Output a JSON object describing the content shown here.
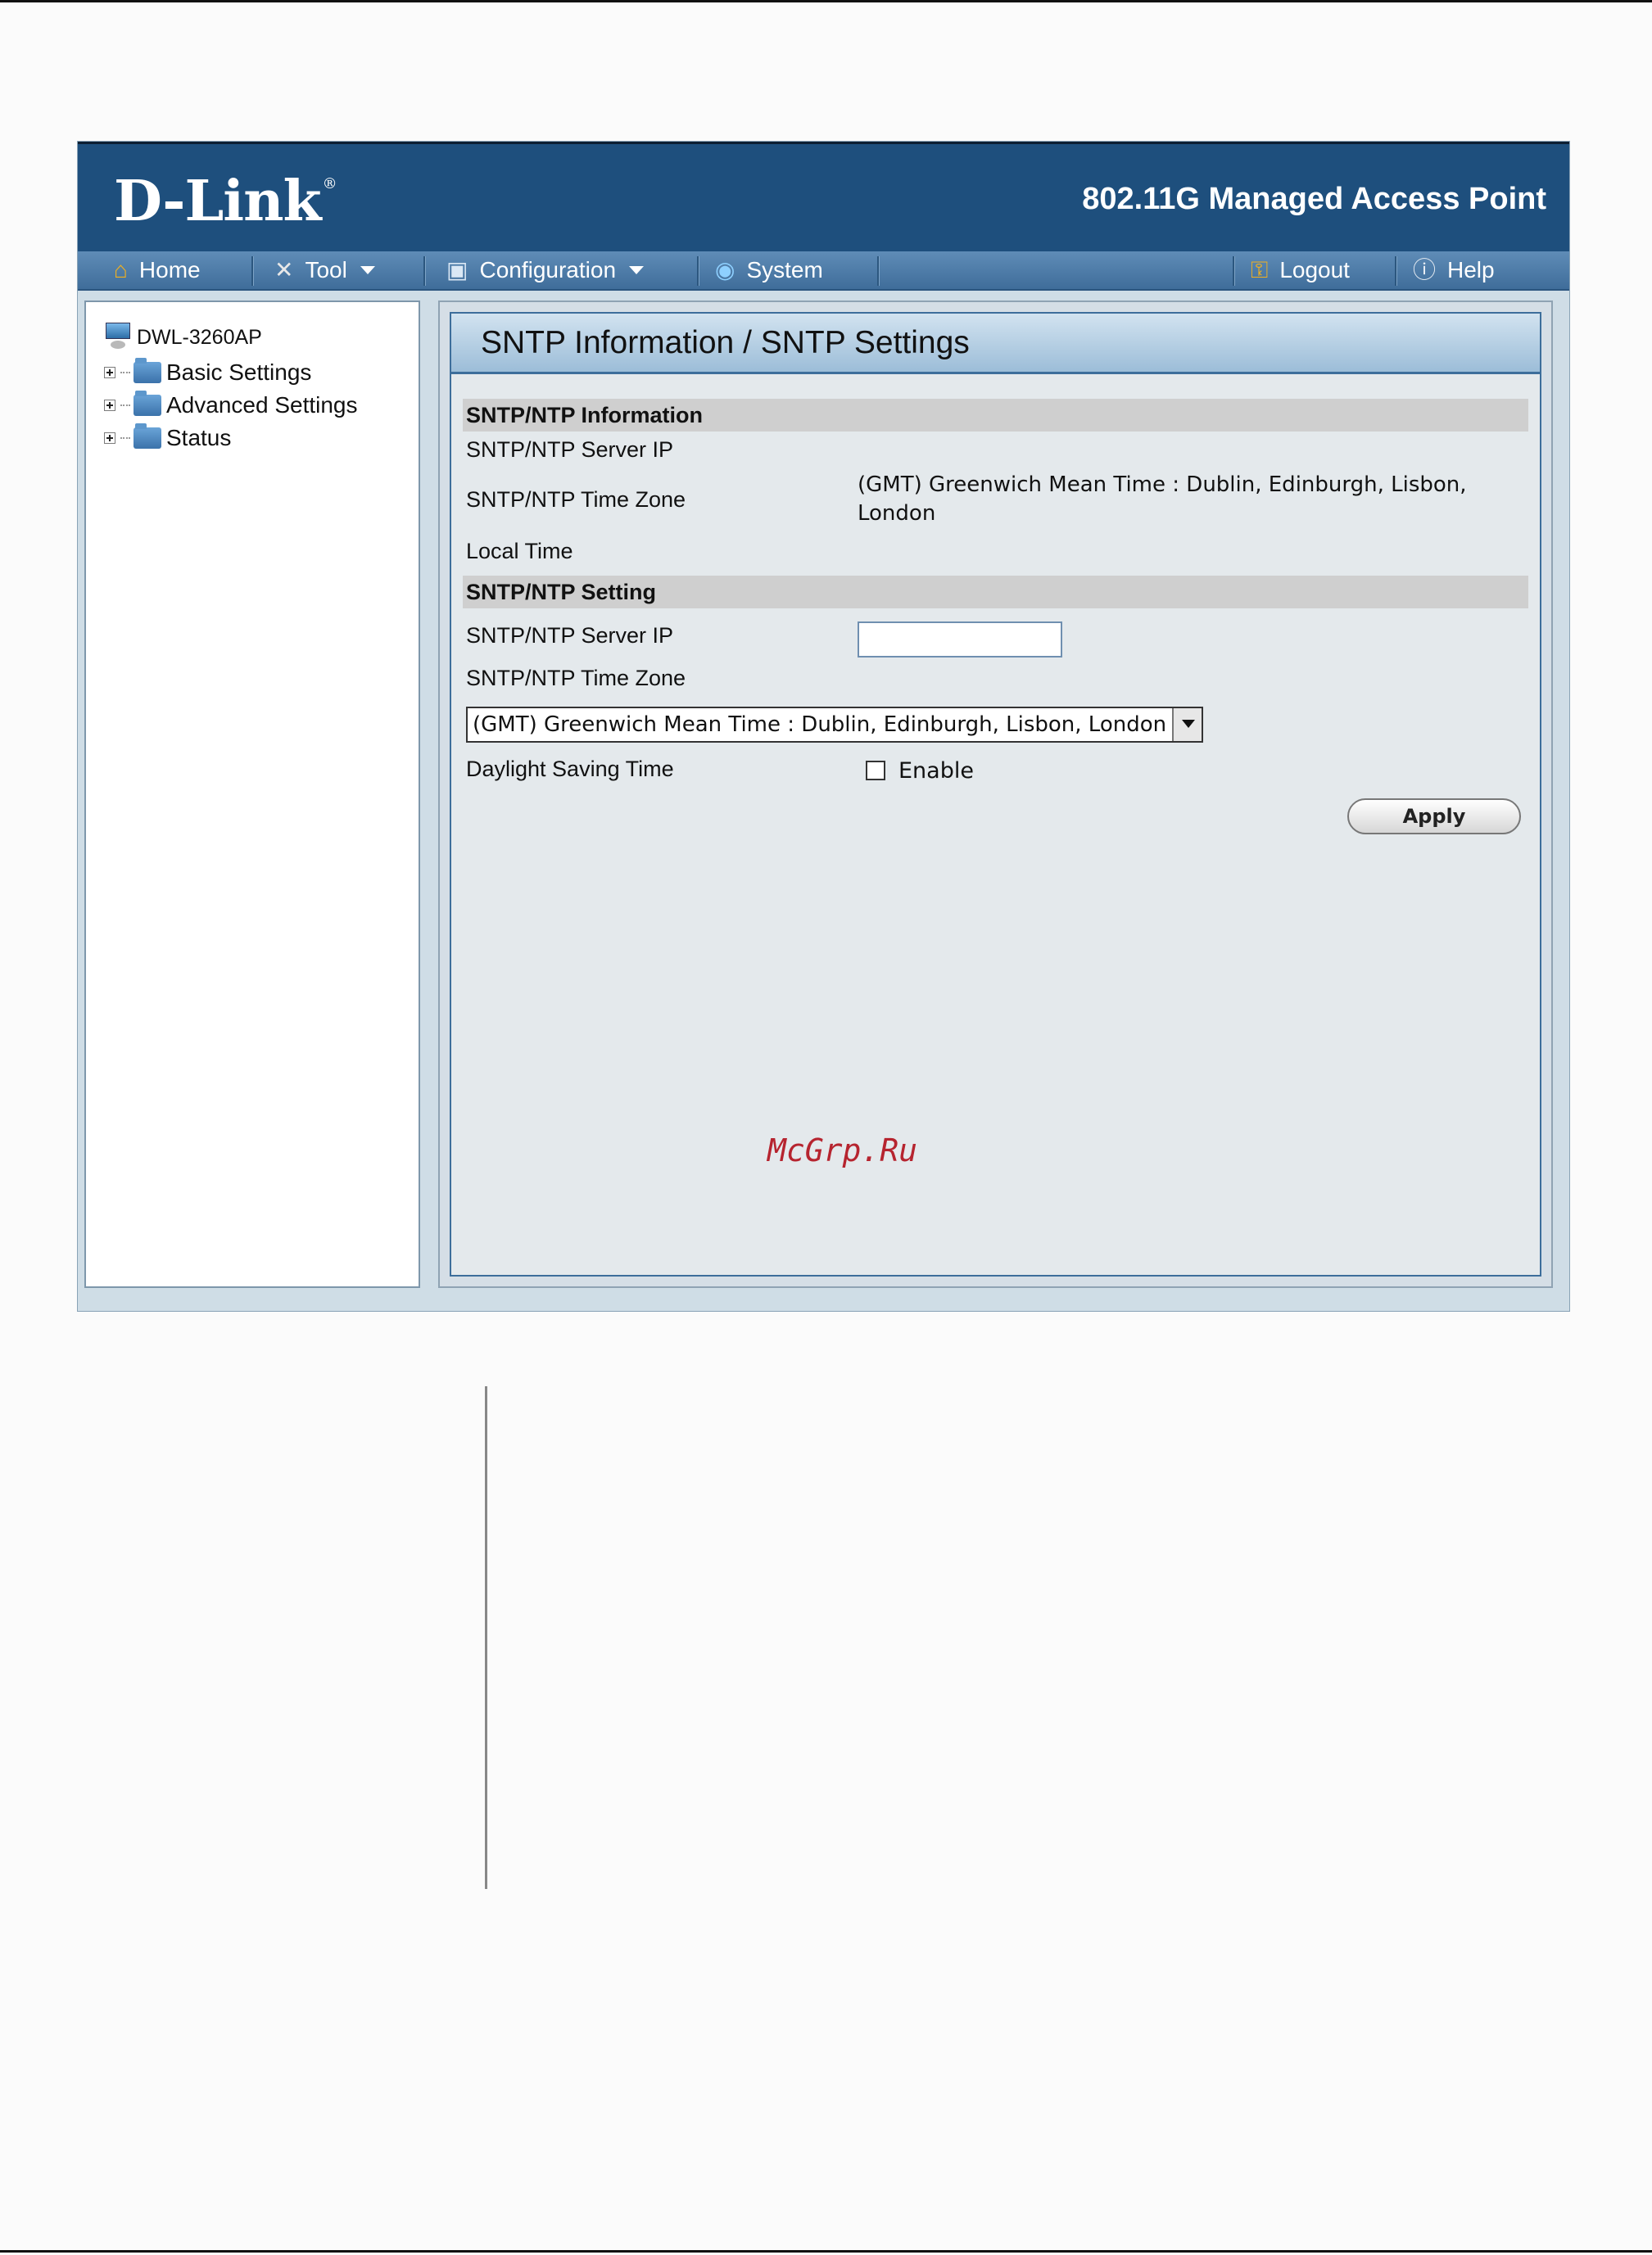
{
  "header": {
    "logo_text": "D-Link",
    "logo_mark": "®",
    "product_title": "802.11G Managed Access Point"
  },
  "menu": {
    "home": "Home",
    "tool": "Tool",
    "configuration": "Configuration",
    "system": "System",
    "logout": "Logout",
    "help": "Help"
  },
  "sidebar": {
    "root": "DWL-3260AP",
    "items": [
      {
        "label": "Basic Settings"
      },
      {
        "label": "Advanced Settings"
      },
      {
        "label": "Status"
      }
    ]
  },
  "page": {
    "title": "SNTP Information / SNTP Settings"
  },
  "info_section": {
    "heading": "SNTP/NTP Information",
    "server_ip_label": "SNTP/NTP Server IP",
    "time_zone_label": "SNTP/NTP Time Zone",
    "time_zone_value": "(GMT) Greenwich Mean Time : Dublin, Edinburgh, Lisbon, London",
    "local_time_label": "Local Time"
  },
  "setting_section": {
    "heading": "SNTP/NTP Setting",
    "server_ip_label": "SNTP/NTP Server IP",
    "server_ip_value": "",
    "time_zone_label": "SNTP/NTP Time Zone",
    "time_zone_selected": "(GMT) Greenwich Mean Time : Dublin, Edinburgh, Lisbon, London",
    "dst_label": "Daylight Saving Time",
    "dst_checkbox_label": "Enable",
    "dst_checked": false,
    "apply_label": "Apply"
  },
  "watermark": "McGrp.Ru",
  "colors": {
    "banner": "#1e4f7d",
    "menubar": "#4a79a6",
    "section_head": "#cfcfcf",
    "watermark": "#b6242f"
  }
}
